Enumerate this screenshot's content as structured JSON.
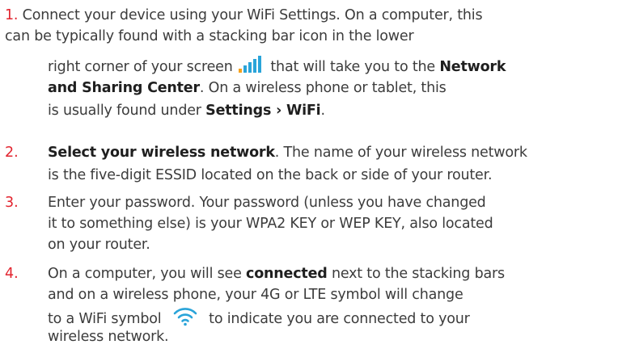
{
  "colors": {
    "accent": "#e2242f",
    "text": "#3c3c3c",
    "icon_blue": "#2aa4d9",
    "icon_orange": "#f7a21b"
  },
  "step1": {
    "number": "1.",
    "line1": "Connect your device using your WiFi Settings. On a computer, this",
    "line2": "can be typically found with a stacking bar icon in the lower",
    "line3a": "right corner of your screen",
    "line3b": "that will take you to the",
    "bold_network": "Network",
    "bold_sharing": "and Sharing Center",
    "line4b": ". On a wireless phone or tablet, this",
    "line5a": "is usually found under",
    "bold_settings": "Settings › WiFi",
    "line5b": ".",
    "icon": "stacking-bars-icon"
  },
  "step2": {
    "number": "2.",
    "bold_select": "Select your wireless network",
    "line1b": ". The name of your wireless network",
    "line2": "is the five-digit ESSID located on the back or side of your router."
  },
  "step3": {
    "number": "3.",
    "line1": "Enter your password. Your password (unless you have changed",
    "line2": "it to something else) is your WPA2 KEY or WEP KEY, also located",
    "line3": "on your router."
  },
  "step4": {
    "number": "4.",
    "line1a": "On a computer, you will see",
    "bold_connected": "connected",
    "line1b": "next to the stacking bars",
    "line2": "and on a wireless phone, your 4G or LTE symbol will change",
    "line3a": "to a WiFi symbol",
    "line3b": "to indicate you are connected to your",
    "line4": "wireless network.",
    "icon": "wifi-icon"
  }
}
